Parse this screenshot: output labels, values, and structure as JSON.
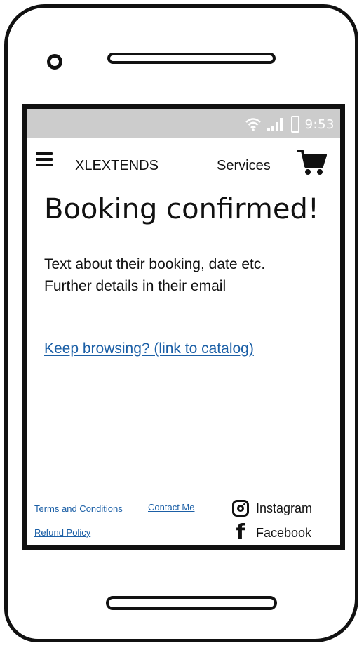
{
  "status_bar": {
    "time": "9:53"
  },
  "nav": {
    "brand": "XLEXTENDS",
    "services_label": "Services"
  },
  "main": {
    "title": "Booking confirmed!",
    "body_line_1": "Text about their booking, date etc.",
    "body_line_2": "Further details in their email",
    "catalog_link": "Keep browsing? (link to catalog)"
  },
  "footer": {
    "terms_label": "Terms and Conditions",
    "contact_label": "Contact Me",
    "refund_label": "Refund Policy",
    "instagram_label": "Instagram",
    "facebook_label": "Facebook"
  },
  "icons": {
    "menu": "hamburger-menu-icon",
    "cart": "shopping-cart-icon",
    "wifi": "wifi-icon",
    "signal": "signal-icon",
    "battery": "battery-icon",
    "instagram": "instagram-icon",
    "facebook": "facebook-icon"
  },
  "colors": {
    "link": "#1b5fa6",
    "status_bar": "#cccccc",
    "frame": "#111111"
  }
}
